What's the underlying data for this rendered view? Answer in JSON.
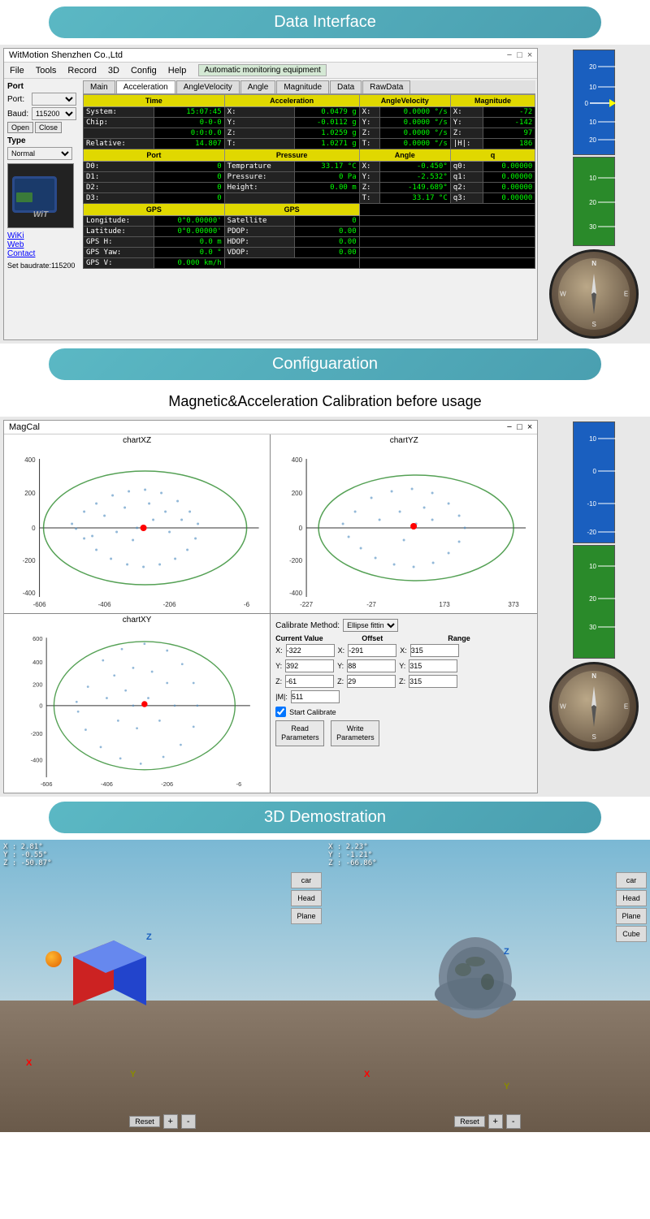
{
  "sections": {
    "data_interface": "Data Interface",
    "configuration": "Configuaration",
    "calibration_title": "Magnetic&Acceleration Calibration before usage",
    "td_demo": "3D Demostration"
  },
  "window": {
    "title": "WitMotion Shenzhen Co.,Ltd",
    "menus": [
      "File",
      "Tools",
      "Record",
      "3D",
      "Config",
      "Help"
    ],
    "badge": "Automatic monitoring equipment",
    "controls": [
      "−",
      "□",
      "×"
    ]
  },
  "port": {
    "label": "Port",
    "port_label": "Port:",
    "baud_label": "Baud:",
    "baud_value": "115200",
    "open_btn": "Open",
    "close_btn": "Close",
    "type_label": "Type",
    "type_value": "Normal",
    "baudrate_status": "Set baudrate:115200"
  },
  "links": {
    "wiki": "WiKi",
    "web": "Web",
    "contact": "Contact"
  },
  "tabs": {
    "main": "Main",
    "acceleration": "Acceleration",
    "angle_velocity": "AngleVelocity",
    "angle": "Angle",
    "magnitude": "Magnitude",
    "data": "Data",
    "raw_data": "RawData"
  },
  "time_section": {
    "header": "Time",
    "system_label": "System:",
    "system_value": "15:07:45",
    "chip_label": "Chip:",
    "chip_value": "0-0-0",
    "time_value": "0:0:0.0",
    "relative_label": "Relative:",
    "relative_value": "14.807"
  },
  "acceleration": {
    "header": "Acceleration",
    "x_label": "X:",
    "x_value": "0.0479 g",
    "y_label": "Y:",
    "y_value": "-0.0112 g",
    "z_label": "Z:",
    "z_value": "1.0259 g",
    "t_label": "T:",
    "t_value": "1.0271 g"
  },
  "angle_velocity": {
    "header": "AngleVelocity",
    "x_value": "0.0000 °/s",
    "y_value": "0.0000 °/s",
    "z_value": "0.0000 °/s",
    "t_value": "0.0000 °/s"
  },
  "magnitude_section": {
    "header": "Magnitude",
    "x_value": "-72",
    "y_value": "-142",
    "z_value": "97",
    "h_label": "|H|:",
    "h_value": "186"
  },
  "port_section": {
    "header": "Port",
    "d0_label": "D0:",
    "d0_value": "0",
    "d1_label": "D1:",
    "d1_value": "0",
    "d2_label": "D2:",
    "d2_value": "0",
    "d3_label": "D3:",
    "d3_value": "0"
  },
  "pressure": {
    "header": "Pressure",
    "temp_label": "Temprature",
    "temp_value": "33.17 °C",
    "pressure_label": "Pressure:",
    "pressure_value": "0 Pa",
    "height_label": "Height:",
    "height_value": "0.00 m"
  },
  "angle": {
    "header": "Angle",
    "x_value": "-0.450°",
    "y_value": "-2.532°",
    "z_value": "-149.689°",
    "t_value": "33.17 °C"
  },
  "q_section": {
    "header": "q",
    "q0_label": "q0:",
    "q0_value": "0.00000",
    "q1_label": "q1:",
    "q1_value": "0.00000",
    "q2_label": "q2:",
    "q2_value": "0.00000",
    "q3_label": "q3:",
    "q3_value": "0.00000"
  },
  "gps_section": {
    "header1": "GPS",
    "header2": "GPS",
    "longitude_label": "Longitude:",
    "longitude_value": "0°0.00000'",
    "latitude_label": "Latitude:",
    "latitude_value": "0°0.00000'",
    "gps_h_label": "GPS H:",
    "gps_h_value": "0.0 m",
    "gps_yaw_label": "GPS Yaw:",
    "gps_yaw_value": "0.0 °",
    "gps_v_label": "GPS V:",
    "gps_v_value": "0.000 km/h",
    "satellite_label": "Satellite",
    "satellite_value": "0",
    "pdop_label": "PDOP:",
    "pdop_value": "0.00",
    "hdop_label": "HDOP:",
    "hdop_value": "0.00",
    "vdop_label": "VDOP:",
    "vdop_value": "0.00"
  },
  "magcal": {
    "window_title": "MagCal",
    "chart_xz": "chartXZ",
    "chart_yz": "chartYZ",
    "chart_xy": "chartXY",
    "xz_x_labels": [
      "-606",
      "-406",
      "-206",
      "-6"
    ],
    "xz_y_labels": [
      "400",
      "200",
      "0",
      "-200",
      "-400"
    ],
    "yz_x_labels": [
      "-227",
      "-27",
      "173",
      "373"
    ],
    "yz_y_labels": [
      "400",
      "200",
      "0",
      "-200",
      "-400"
    ],
    "xy_x_labels": [
      "-606",
      "-406",
      "-206",
      "-6"
    ],
    "xy_y_labels": [
      "600",
      "400",
      "200",
      "0",
      "-200",
      "-400"
    ],
    "calibrate_method_label": "Calibrate Method:",
    "calibrate_method_value": "Ellipse fittin",
    "current_value_label": "Current Value",
    "offset_label": "Offset",
    "range_label": "Range",
    "cv_x_label": "X:",
    "cv_x_value": "-322",
    "cv_y_label": "Y:",
    "cv_y_value": "392",
    "cv_z_label": "Z:",
    "cv_z_value": "-61",
    "cv_mag_label": "|M|:",
    "cv_mag_value": "511",
    "off_x_value": "-291",
    "off_y_value": "88",
    "off_z_value": "29",
    "range_x_value": "315",
    "range_y_value": "315",
    "range_z_value": "315",
    "start_calibrate": "Start Calibrate",
    "read_params": "Read\nParameters",
    "write_params": "Write\nParameters"
  },
  "td3d": {
    "view1_coords": "X : 2.81°\nY : -0.55°\nZ : -50.87°",
    "view2_coords": "X : 2.23°\nY : -1.21°\nZ : -66.86°",
    "buttons": [
      "car",
      "Head",
      "Plane"
    ],
    "buttons2": [
      "car",
      "Head",
      "Plane",
      "Cube"
    ],
    "reset": "Reset"
  },
  "ruler": {
    "blue_ticks": [
      "20",
      "10",
      "0",
      "10",
      "20"
    ],
    "green_ticks": [
      "10",
      "20",
      "30"
    ]
  }
}
